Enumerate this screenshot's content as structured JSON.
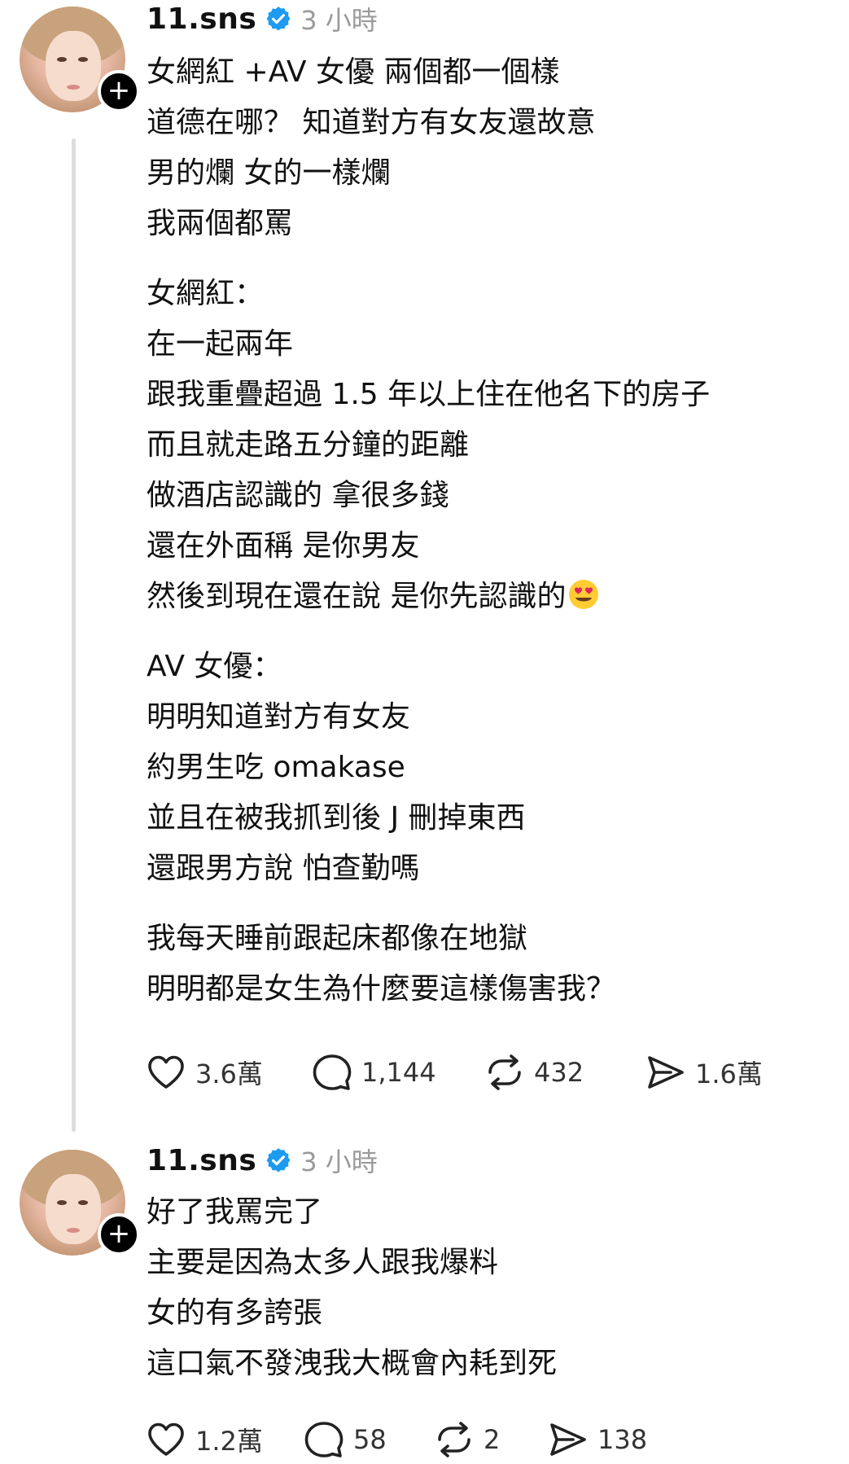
{
  "colors": {
    "text": "#111111",
    "muted": "#9a9a9a",
    "verified": "#1d9bf0",
    "thread_line": "#dddddd",
    "follow_badge": "#000000"
  },
  "posts": [
    {
      "username": "11.sns",
      "verified_icon": "verified-badge-icon",
      "timestamp": "3 小時",
      "follow_icon": "+",
      "lines": [
        "女網紅 +AV 女優 兩個都一個樣",
        "道德在哪？ 知道對方有女友還故意",
        "男的爛 女的一樣爛",
        "我兩個都罵",
        "女網紅：",
        "在一起兩年",
        "跟我重疊超過 1.5 年以上住在他名下的房子",
        "而且就走路五分鐘的距離",
        "做酒店認識的 拿很多錢",
        "還在外面稱 是你男友",
        "然後到現在還在說 是你先認識的",
        "AV 女優：",
        "明明知道對方有女友",
        "約男生吃 omakase",
        "並且在被我抓到後 J 刪掉東西",
        "還跟男方說 怕查勤嗎",
        "我每天睡前跟起床都像在地獄",
        "明明都是女生為什麼要這樣傷害我？"
      ],
      "emoji": "smiling-face-with-heart-eyes-icon",
      "stats": {
        "likes": "3.6萬",
        "comments": "1,144",
        "reposts": "432",
        "shares": "1.6萬"
      }
    },
    {
      "username": "11.sns",
      "verified_icon": "verified-badge-icon",
      "timestamp": "3 小時",
      "follow_icon": "+",
      "lines": [
        "好了我罵完了",
        "主要是因為太多人跟我爆料",
        "女的有多誇張",
        "這口氣不發洩我大概會內耗到死"
      ],
      "stats": {
        "likes": "1.2萬",
        "comments": "58",
        "reposts": "2",
        "shares": "138"
      }
    }
  ]
}
